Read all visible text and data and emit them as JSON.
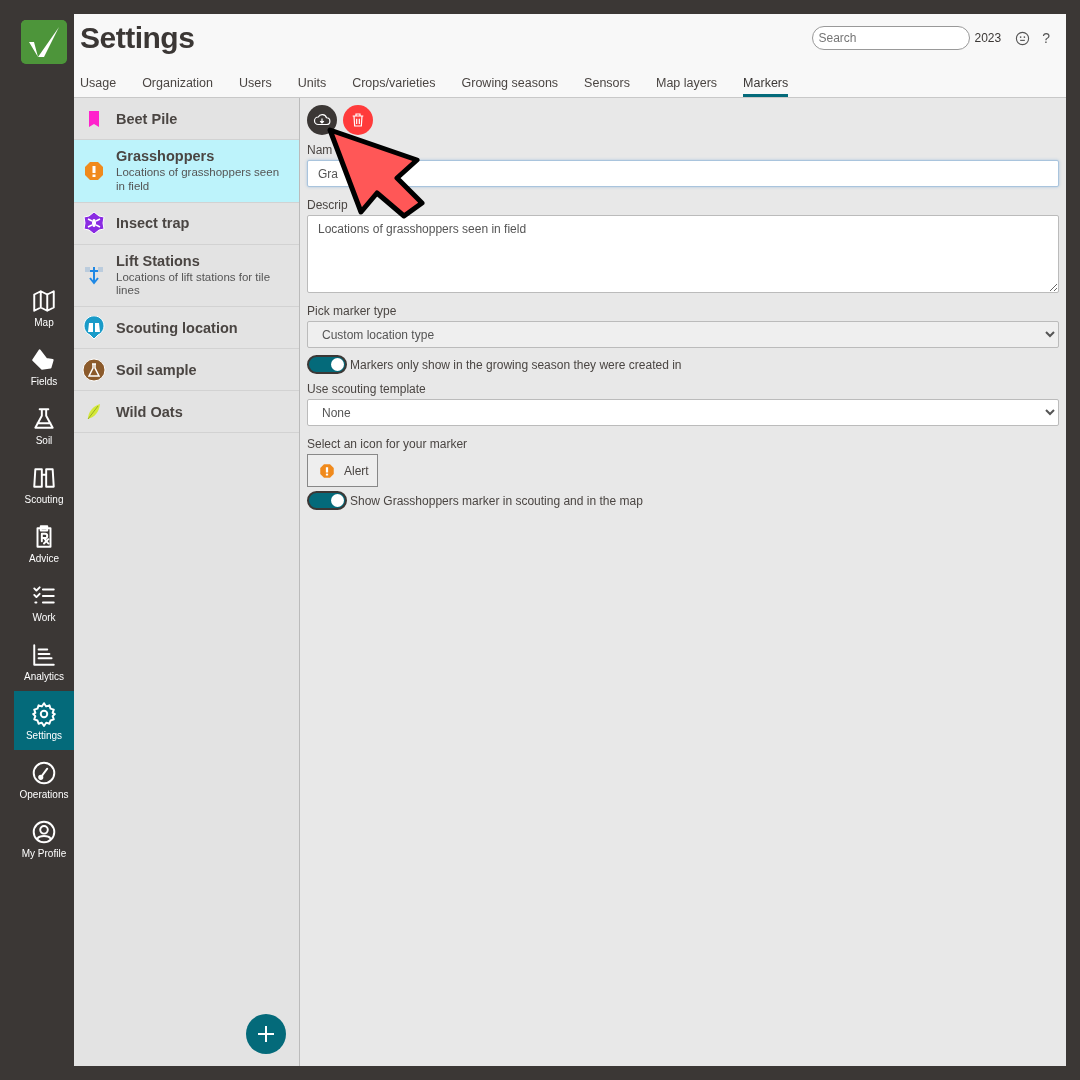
{
  "nav": [
    {
      "label": "Map",
      "selected": false
    },
    {
      "label": "Fields",
      "selected": false
    },
    {
      "label": "Soil",
      "selected": false
    },
    {
      "label": "Scouting",
      "selected": false
    },
    {
      "label": "Advice",
      "selected": false
    },
    {
      "label": "Work",
      "selected": false
    },
    {
      "label": "Analytics",
      "selected": false
    },
    {
      "label": "Settings",
      "selected": true
    },
    {
      "label": "Operations",
      "selected": false
    },
    {
      "label": "My Profile",
      "selected": false
    }
  ],
  "header": {
    "title": "Settings",
    "search": {
      "placeholder": "Search"
    },
    "year": "2023",
    "help": "?"
  },
  "tabs": [
    {
      "label": "Usage",
      "selected": false
    },
    {
      "label": "Organization",
      "selected": false
    },
    {
      "label": "Users",
      "selected": false
    },
    {
      "label": "Units",
      "selected": false
    },
    {
      "label": "Crops/varieties",
      "selected": false
    },
    {
      "label": "Growing seasons",
      "selected": false
    },
    {
      "label": "Sensors",
      "selected": false
    },
    {
      "label": "Map layers",
      "selected": false
    },
    {
      "label": "Markers",
      "selected": true
    }
  ],
  "markers": [
    {
      "title": "Beet Pile",
      "selected": false
    },
    {
      "title": "Grasshoppers",
      "description": "Locations of grasshoppers seen in field",
      "selected": true
    },
    {
      "title": "Insect trap",
      "selected": false
    },
    {
      "title": "Lift Stations",
      "description": "Locations of lift stations for tile lines",
      "selected": false
    },
    {
      "title": "Scouting location",
      "selected": false
    },
    {
      "title": "Soil sample",
      "selected": false
    },
    {
      "title": "Wild Oats",
      "selected": false
    }
  ],
  "form": {
    "name_label": "Nam",
    "name_value": "Gra",
    "description_label": "Descrip",
    "description_value": "Locations of grasshoppers seen in field",
    "marker_type_label": "Pick marker type",
    "marker_type_value": "Custom location type",
    "season_toggle": {
      "label": "Markers only show in the growing season they were created in",
      "on": true
    },
    "template_label": "Use scouting template",
    "template_value": "None",
    "icon_label": "Select an icon for your marker",
    "icon_value": "Alert",
    "show_toggle": {
      "label": "Show Grasshoppers marker in scouting and in the map",
      "on": true
    }
  }
}
